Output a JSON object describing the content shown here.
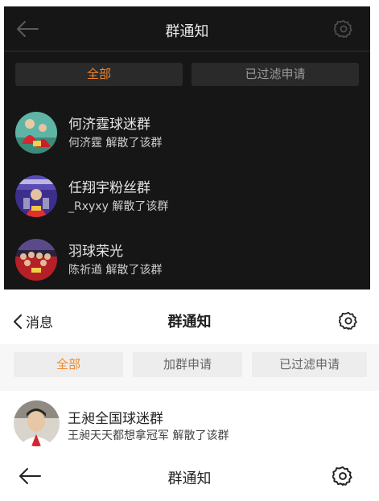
{
  "panel1": {
    "title": "群通知",
    "icons": {
      "back": "back-arrow-icon",
      "settings": "gear-icon"
    },
    "tabs": [
      {
        "label": "全部",
        "active": true
      },
      {
        "label": "已过滤申请",
        "active": false
      }
    ],
    "items": [
      {
        "name": "何济霆球迷群",
        "actor": "何济霆",
        "action": "解散了该群"
      },
      {
        "name": "任翔宇粉丝群",
        "actor": "_Rxyxy",
        "action": "解散了该群"
      },
      {
        "name": "羽球荣光",
        "actor": "陈祈遒",
        "action": "解散了该群"
      }
    ]
  },
  "panel2": {
    "back_label": "消息",
    "title": "群通知",
    "icons": {
      "back": "chevron-left-icon",
      "settings": "gear-icon"
    },
    "tabs": [
      {
        "label": "全部",
        "active": true
      },
      {
        "label": "加群申请",
        "active": false
      },
      {
        "label": "已过滤申请",
        "active": false
      }
    ],
    "items": [
      {
        "name": "王昶全国球迷群",
        "actor": "王昶天天都想拿冠军",
        "action": "解散了该群"
      }
    ]
  },
  "panel3": {
    "title": "群通知",
    "icons": {
      "back": "back-arrow-icon",
      "settings": "gear-icon"
    }
  },
  "colors": {
    "accent": "#f0832a",
    "dark_bg": "#161616",
    "dark_tab_bg": "#2a2a2a",
    "light_tab_bg": "#ededed"
  }
}
